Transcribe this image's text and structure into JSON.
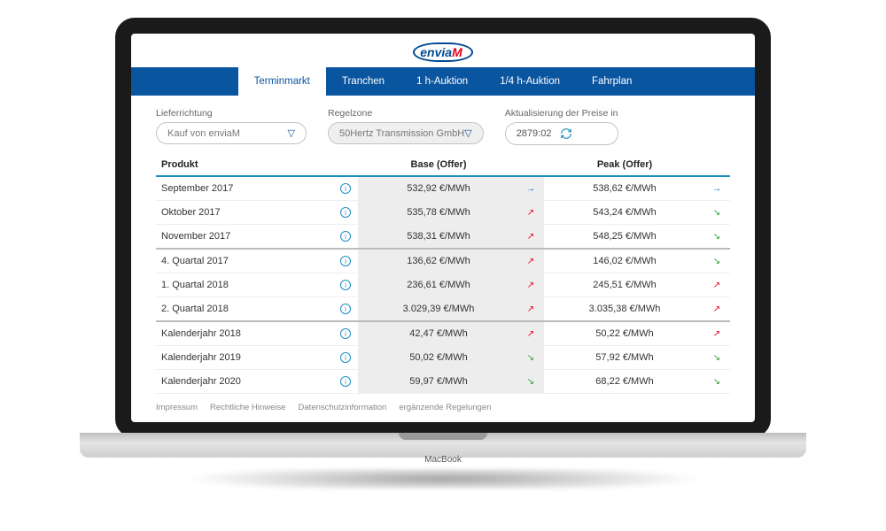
{
  "logo": {
    "brand": "envia",
    "accent": "M"
  },
  "tabs": [
    {
      "label": "Terminmarkt",
      "active": true
    },
    {
      "label": "Tranchen"
    },
    {
      "label": "1 h-Auktion"
    },
    {
      "label": "1/4 h-Auktion"
    },
    {
      "label": "Fahrplan"
    }
  ],
  "filters": {
    "direction": {
      "label": "Lieferrichtung",
      "value": "Kauf von enviaM"
    },
    "zone": {
      "label": "Regelzone",
      "value": "50Hertz Transmission GmbH"
    },
    "refresh": {
      "label": "Aktualisierung der Preise in",
      "value": "2879:02"
    }
  },
  "columns": {
    "product": "Produkt",
    "base": "Base (Offer)",
    "peak": "Peak (Offer)"
  },
  "unit": "€/MWh",
  "rows": [
    {
      "product": "September 2017",
      "base": "532,92",
      "baseTrend": "flat",
      "peak": "538,62",
      "peakTrend": "flat",
      "sep": false
    },
    {
      "product": "Oktober 2017",
      "base": "535,78",
      "baseTrend": "up",
      "peak": "543,24",
      "peakTrend": "down",
      "sep": false
    },
    {
      "product": "November 2017",
      "base": "538,31",
      "baseTrend": "up",
      "peak": "548,25",
      "peakTrend": "down",
      "sep": true
    },
    {
      "product": "4. Quartal 2017",
      "base": "136,62",
      "baseTrend": "up",
      "peak": "146,02",
      "peakTrend": "down",
      "sep": false
    },
    {
      "product": "1. Quartal 2018",
      "base": "236,61",
      "baseTrend": "up",
      "peak": "245,51",
      "peakTrend": "up",
      "sep": false
    },
    {
      "product": "2. Quartal 2018",
      "base": "3.029,39",
      "baseTrend": "up",
      "peak": "3.035,38",
      "peakTrend": "up",
      "sep": true
    },
    {
      "product": "Kalenderjahr 2018",
      "base": "42,47",
      "baseTrend": "up",
      "peak": "50,22",
      "peakTrend": "up",
      "sep": false
    },
    {
      "product": "Kalenderjahr 2019",
      "base": "50,02",
      "baseTrend": "down",
      "peak": "57,92",
      "peakTrend": "down",
      "sep": false
    },
    {
      "product": "Kalenderjahr 2020",
      "base": "59,97",
      "baseTrend": "down",
      "peak": "68,22",
      "peakTrend": "down",
      "sep": false
    }
  ],
  "footer": [
    "Impressum",
    "Rechtliche Hinweise",
    "Datenschutzinformation",
    "ergänzende Regelungen"
  ]
}
